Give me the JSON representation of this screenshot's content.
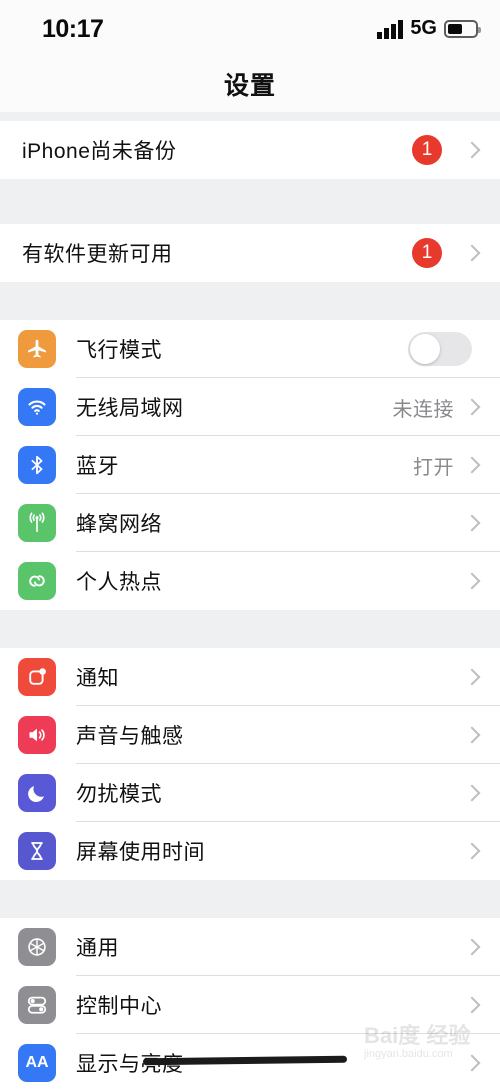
{
  "status_bar": {
    "time": "10:17",
    "network": "5G",
    "signal_bars": 4,
    "battery_level_pct": 55
  },
  "header": {
    "title": "设置"
  },
  "colors": {
    "badge_red": "#e8392d",
    "airplane_orange": "#f09a3e",
    "wifi_blue": "#3478f6",
    "bluetooth_blue": "#3478f6",
    "cellular_green": "#5ac46b",
    "hotspot_green": "#5ac46b",
    "notifications_red": "#ef4a3a",
    "sounds_pink": "#ee3b56",
    "dnd_indigo": "#5959d8",
    "screentime_indigo": "#5757d0",
    "general_gray": "#8e8e93",
    "control_center_gray": "#8e8e93",
    "display_blue": "#3478f6",
    "value_text_gray": "#8a8a8e",
    "chevron_gray": "#bdbdc2"
  },
  "sections": [
    {
      "name": "alerts-backup",
      "rows": [
        {
          "key": "backup",
          "label": "iPhone尚未备份",
          "has_icon": false,
          "badge": "1",
          "accessory": "chevron"
        }
      ]
    },
    {
      "name": "alerts-update",
      "rows": [
        {
          "key": "software-update",
          "label": "有软件更新可用",
          "has_icon": false,
          "badge": "1",
          "accessory": "chevron"
        }
      ]
    },
    {
      "name": "connectivity",
      "rows": [
        {
          "key": "airplane-mode",
          "label": "飞行模式",
          "icon": "airplane-icon",
          "icon_color": "#f09a3e",
          "accessory": "toggle",
          "toggle_on": false
        },
        {
          "key": "wifi",
          "label": "无线局域网",
          "icon": "wifi-icon",
          "icon_color": "#3478f6",
          "value": "未连接",
          "accessory": "chevron"
        },
        {
          "key": "bluetooth",
          "label": "蓝牙",
          "icon": "bluetooth-icon",
          "icon_color": "#3478f6",
          "value": "打开",
          "accessory": "chevron"
        },
        {
          "key": "cellular",
          "label": "蜂窝网络",
          "icon": "cellular-antenna-icon",
          "icon_color": "#5ac46b",
          "accessory": "chevron"
        },
        {
          "key": "personal-hotspot",
          "label": "个人热点",
          "icon": "hotspot-link-icon",
          "icon_color": "#5ac46b",
          "accessory": "chevron"
        }
      ]
    },
    {
      "name": "notifications-sounds",
      "rows": [
        {
          "key": "notifications",
          "label": "通知",
          "icon": "notifications-icon",
          "icon_color": "#ef4a3a",
          "accessory": "chevron"
        },
        {
          "key": "sounds-haptics",
          "label": "声音与触感",
          "icon": "speaker-icon",
          "icon_color": "#ee3b56",
          "accessory": "chevron"
        },
        {
          "key": "do-not-disturb",
          "label": "勿扰模式",
          "icon": "moon-icon",
          "icon_color": "#5959d8",
          "accessory": "chevron"
        },
        {
          "key": "screen-time",
          "label": "屏幕使用时间",
          "icon": "hourglass-icon",
          "icon_color": "#5757d0",
          "accessory": "chevron"
        }
      ]
    },
    {
      "name": "general-group",
      "rows": [
        {
          "key": "general",
          "label": "通用",
          "icon": "gear-icon",
          "icon_color": "#8e8e93",
          "accessory": "chevron"
        },
        {
          "key": "control-center",
          "label": "控制中心",
          "icon": "toggles-icon",
          "icon_color": "#8e8e93",
          "accessory": "chevron"
        },
        {
          "key": "display-brightness",
          "label": "显示与亮度",
          "icon": "aa-text-icon",
          "icon_color": "#3478f6",
          "accessory": "chevron"
        }
      ]
    }
  ],
  "watermark": {
    "main": "Bai度 经验",
    "sub": "jingyan.baidu.com"
  }
}
